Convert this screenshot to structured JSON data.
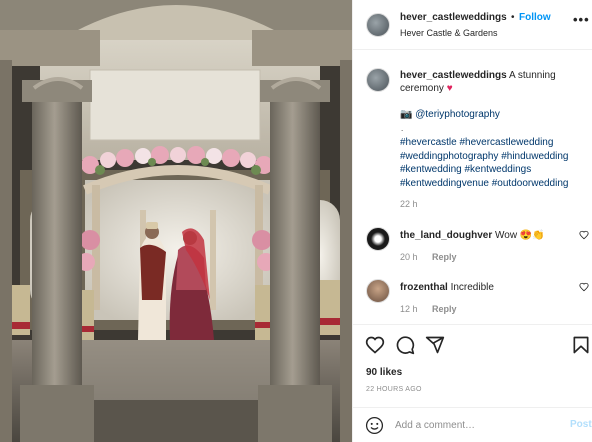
{
  "header": {
    "username": "hever_castleweddings",
    "dot": "•",
    "follow_label": "Follow",
    "location": "Hever Castle & Gardens",
    "more_label": "•••"
  },
  "caption": {
    "username": "hever_castleweddings",
    "text": "A stunning ceremony",
    "heart": "♥",
    "credit_icon": "📷",
    "credit": "@teriyphotography",
    "separator": ".",
    "hashtags": "#hevercastle #hevercastlewedding #weddingphotography #hinduwedding #kentwedding #kentweddings #kentweddingvenue #outdoorwedding",
    "time": "22 h"
  },
  "comments": [
    {
      "username": "the_land_doughver",
      "text": "Wow",
      "emoji": "😍👏",
      "time": "20 h",
      "reply_label": "Reply"
    },
    {
      "username": "frozenthal",
      "text": "Incredible",
      "time": "12 h",
      "reply_label": "Reply"
    }
  ],
  "stats": {
    "likes": "90 likes",
    "posted_ago": "22 HOURS AGO"
  },
  "add_comment": {
    "placeholder": "Add a comment…",
    "post_label": "Post"
  },
  "colors": {
    "link_blue": "#0095f6",
    "hashtag_blue": "#00376b",
    "heart_red": "#e0245e",
    "muted_gray": "#8e8e8e"
  },
  "icons": [
    "heart-icon",
    "comment-icon",
    "share-icon",
    "bookmark-icon",
    "emoji-icon",
    "more-options-icon"
  ]
}
